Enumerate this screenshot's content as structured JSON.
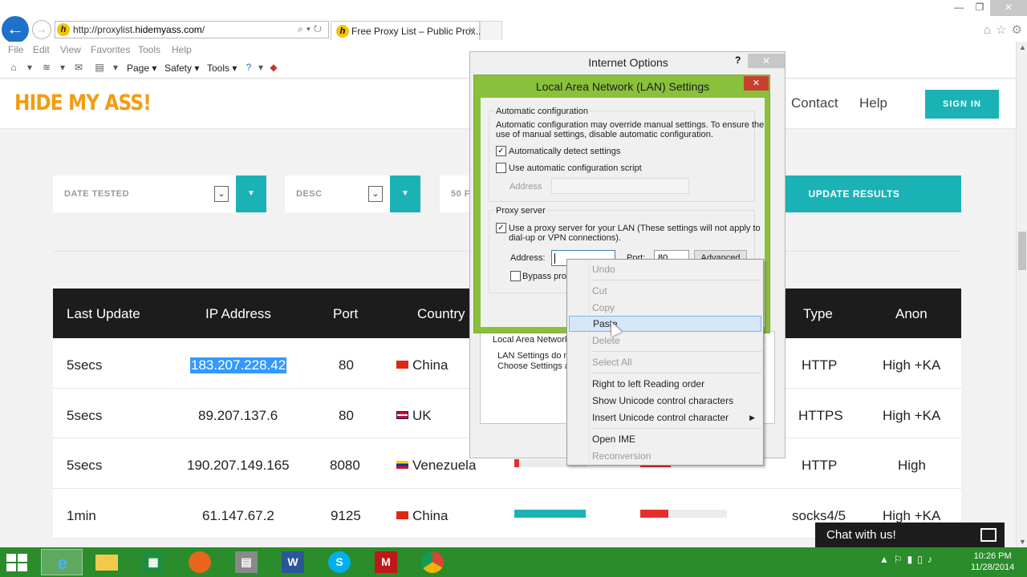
{
  "browser": {
    "address_url_prefix": "http://proxylist.",
    "address_url_domain": "hidemyass.com",
    "address_url_suffix": "/",
    "tab_title": "Free Proxy List – Public Prox...",
    "menu": [
      "File",
      "Edit",
      "View",
      "Favorites",
      "Tools",
      "Help"
    ],
    "commands": {
      "page": "Page",
      "safety": "Safety",
      "tools": "Tools"
    }
  },
  "site": {
    "logo": "HIDE MY ASS!",
    "nav": {
      "contact": "Contact",
      "help": "Help"
    },
    "signin": "SIGN IN",
    "filters": {
      "sort_by": "DATE TESTED",
      "order": "DESC",
      "per_page": "50 F"
    },
    "update_button": "UPDATE RESULTS"
  },
  "table": {
    "headers": [
      "Last Update",
      "IP Address",
      "Port",
      "Country",
      "Type",
      "Anon"
    ],
    "rows": [
      {
        "last_update": "5secs",
        "ip": "183.207.228.42",
        "port": "80",
        "country": "China",
        "type": "HTTP",
        "anon": "High +KA"
      },
      {
        "last_update": "5secs",
        "ip": "89.207.137.6",
        "port": "80",
        "country": "UK",
        "type": "HTTPS",
        "anon": "High +KA"
      },
      {
        "last_update": "5secs",
        "ip": "190.207.149.165",
        "port": "8080",
        "country": "Venezuela",
        "type": "HTTP",
        "anon": "High"
      },
      {
        "last_update": "1min",
        "ip": "61.147.67.2",
        "port": "9125",
        "country": "China",
        "type": "socks4/5",
        "anon": "High +KA"
      }
    ]
  },
  "internet_options": {
    "title": "Internet Options",
    "lan_label": "Local Area Network (",
    "lan_desc_1": "LAN Settings do no",
    "lan_desc_2": "Choose Settings ab"
  },
  "lan_dialog": {
    "title": "Local Area Network (LAN) Settings",
    "auto_group": "Automatic configuration",
    "auto_desc_1": "Automatic configuration may override manual settings.  To ensure the",
    "auto_desc_2": "use of manual settings, disable automatic configuration.",
    "auto_detect": "Automatically detect settings",
    "auto_script": "Use automatic configuration script",
    "address_label": "Address",
    "proxy_group": "Proxy server",
    "use_proxy_1": "Use a proxy server for your LAN (These settings will not apply to",
    "use_proxy_2": "dial-up or VPN connections).",
    "proxy_address_label": "Address:",
    "port_label": "Port:",
    "port_value": "80",
    "advanced": "Advanced",
    "bypass": "Bypass prox"
  },
  "context_menu": {
    "items": [
      "Undo",
      "Cut",
      "Copy",
      "Paste",
      "Delete",
      "Select All",
      "Right to left Reading order",
      "Show Unicode control characters",
      "Insert Unicode control character",
      "Open IME",
      "Reconversion"
    ]
  },
  "chat": {
    "label": "Chat with us!"
  },
  "taskbar": {
    "time": "10:26 PM",
    "date": "11/28/2014"
  },
  "colors": {
    "accent": "#1bb2b6",
    "logo": "#f39c12",
    "taskbar": "#2a8c2a",
    "dialog_frame": "#8ac13c"
  }
}
